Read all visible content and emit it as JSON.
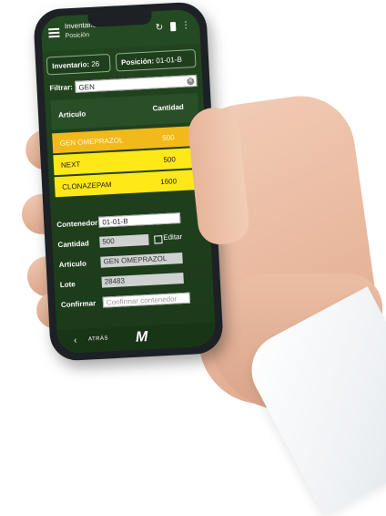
{
  "app": {
    "title": "Inventario",
    "subtitle": "Posición"
  },
  "chips": {
    "inventario_label": "Inventario:",
    "inventario_value": "26",
    "posicion_label": "Posición:",
    "posicion_value": "01-01-B"
  },
  "filter": {
    "label": "Filtrar:",
    "value": "GEN"
  },
  "table": {
    "headers": {
      "articulo": "Articulo",
      "cantidad": "Cantidad"
    },
    "rows": [
      {
        "articulo": "GEN OMEPRAZOL",
        "cantidad": "500",
        "highlight_color": "#f2b91a"
      },
      {
        "articulo": "NEXT",
        "cantidad": "500",
        "highlight_color": "#ffe817"
      },
      {
        "articulo": "CLONAZEPAM",
        "cantidad": "1600",
        "highlight_color": "#ffe817"
      }
    ]
  },
  "form": {
    "contenedor_label": "Contenedor",
    "contenedor_value": "01-01-B",
    "cantidad_label": "Cantidad",
    "cantidad_value": "500",
    "editar_label": "Editar",
    "articulo_label": "Articulo",
    "articulo_value": "GEN OMEPRAZOL",
    "lote_label": "Lote",
    "lote_value": "28483",
    "confirmar_label": "Confirmar",
    "confirmar_placeholder": "Confirmar contenedor"
  },
  "nav": {
    "back_label": "ATRÁS",
    "logo": "M"
  },
  "icons": [
    "menu-icon",
    "sync-icon",
    "clipboard-icon",
    "more-icon",
    "clear-icon",
    "back-arrow-icon"
  ],
  "colors": {
    "app_green": "#244a22",
    "row_orange": "#f2b91a",
    "row_yellow": "#ffe817"
  }
}
